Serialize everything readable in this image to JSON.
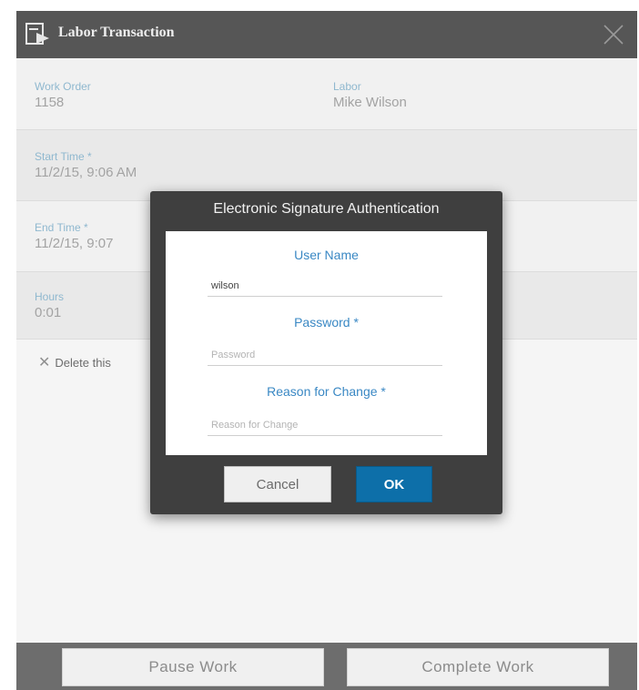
{
  "dialog": {
    "title": "Labor Transaction",
    "icons": {
      "app": "labor-transaction-icon",
      "close": "close-icon"
    }
  },
  "fields": {
    "work_order": {
      "label": "Work Order",
      "value": "1158"
    },
    "labor": {
      "label": "Labor",
      "value": "Mike Wilson"
    },
    "start_time": {
      "label": "Start Time *",
      "value": "11/2/15, 9:06 AM"
    },
    "end_time": {
      "label": "End Time *",
      "value": "11/2/15, 9:07"
    },
    "hours": {
      "label": "Hours",
      "value": "0:01"
    }
  },
  "delete_label": "Delete this",
  "footer": {
    "pause_label": "Pause Work",
    "complete_label": "Complete Work"
  },
  "esig": {
    "title": "Electronic Signature Authentication",
    "user_name_label": "User Name",
    "user_name_value": "wilson",
    "password_label": "Password *",
    "password_placeholder": "Password",
    "reason_label": "Reason for Change *",
    "reason_placeholder": "Reason for Change",
    "cancel_label": "Cancel",
    "ok_label": "OK"
  },
  "colors": {
    "titlebar": "#565656",
    "accent_blue": "#3a88c4",
    "ok_button": "#0d6fa9",
    "modal_bg": "#3f3f3f"
  }
}
